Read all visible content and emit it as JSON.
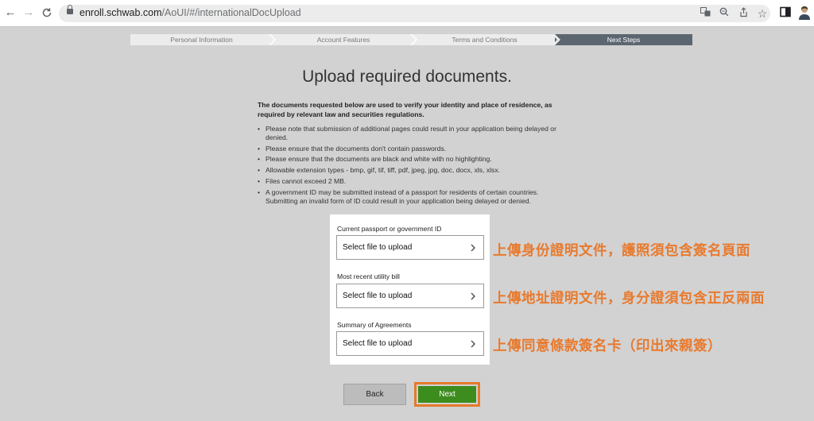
{
  "browser": {
    "url_domain": "enroll.schwab.com",
    "url_path": "/AoUI/#/internationalDocUpload",
    "icons": [
      "back-arrow-icon",
      "forward-arrow-icon",
      "reload-icon",
      "lock-icon",
      "translate-icon",
      "zoom-icon",
      "share-icon",
      "bookmark-star-icon",
      "sidebar-icon",
      "profile-avatar-icon"
    ]
  },
  "progress": {
    "steps": [
      {
        "label": "Personal Information"
      },
      {
        "label": "Account Features"
      },
      {
        "label": "Terms and Conditions"
      },
      {
        "label": "Next Steps"
      }
    ],
    "active_step": 3
  },
  "page": {
    "title": "Upload required documents.",
    "intro": "The documents requested below are used to verify your identity and place of residence, as required by relevant law and securities regulations.",
    "bullets": [
      "Please note that submission of additional pages could result in your application being delayed or denied.",
      "Please ensure that the documents don't contain passwords.",
      "Please ensure that the documents are black and white with no highlighting.",
      "Allowable extension types - bmp, gif, tif, tiff, pdf, jpeg, jpg, doc, docx, xls, xlsx.",
      "Files cannot exceed 2 MB.",
      "A government ID may be submitted instead of a passport for residents of certain countries. Submitting an invalid form of ID could result in your application being delayed or denied."
    ]
  },
  "uploads": [
    {
      "label": "Current passport or government ID",
      "button": "Select file to upload",
      "annotation": "上傳身份證明文件，護照須包含簽名頁面"
    },
    {
      "label": "Most recent utility bill",
      "button": "Select file to upload",
      "annotation": "上傳地址證明文件，身分證須包含正反兩面"
    },
    {
      "label": "Summary of Agreements",
      "button": "Select file to upload",
      "annotation": "上傳同意條款簽名卡（印出來親簽）"
    }
  ],
  "buttons": {
    "back": "Back",
    "next": "Next"
  },
  "colors": {
    "active_step": "#5b6670",
    "next_button": "#3d8c1e",
    "annotation": "#e87a2e",
    "background": "#d2d2d2"
  }
}
